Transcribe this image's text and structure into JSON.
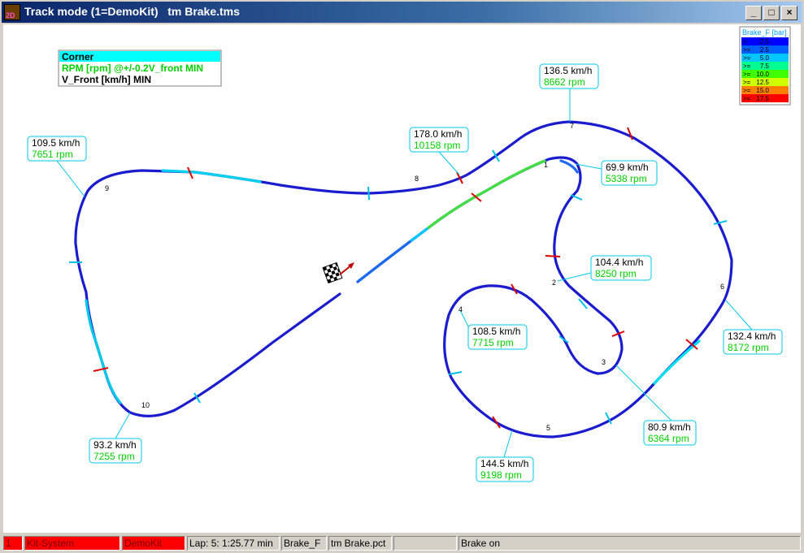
{
  "window": {
    "title": "Track mode (1=DemoKit)   tm Brake.tms",
    "app_icon_label": "2D",
    "minimize_glyph": "_",
    "maximize_glyph": "□",
    "close_glyph": "×"
  },
  "legend_box": {
    "title": "Corner",
    "line1": "RPM [rpm] @+/-0.2V_front MIN",
    "line2": "V_Front [km/h] MIN"
  },
  "color_scale": {
    "title": "Brake_F [bar]",
    "rows": [
      {
        "op": "<",
        "value": "2.5",
        "color": "#0000ff"
      },
      {
        "op": ">=",
        "value": "2.5",
        "color": "#0060ff"
      },
      {
        "op": ">=",
        "value": "5.0",
        "color": "#00c8ff"
      },
      {
        "op": ">=",
        "value": "7.5",
        "color": "#00ff90"
      },
      {
        "op": ">=",
        "value": "10.0",
        "color": "#40ff00"
      },
      {
        "op": ">=",
        "value": "12.5",
        "color": "#d0ff00"
      },
      {
        "op": ">=",
        "value": "15.0",
        "color": "#ff8000"
      },
      {
        "op": ">=",
        "value": "17.5",
        "color": "#ff0000"
      }
    ]
  },
  "corners": [
    {
      "num": "1",
      "speed": "69.9 km/h",
      "rpm": "5338 rpm"
    },
    {
      "num": "2",
      "speed": "104.4 km/h",
      "rpm": "8250 rpm"
    },
    {
      "num": "3",
      "speed": "80.9 km/h",
      "rpm": "6364 rpm"
    },
    {
      "num": "4",
      "speed": "108.5 km/h",
      "rpm": "7715 rpm"
    },
    {
      "num": "5",
      "speed": "144.5 km/h",
      "rpm": "9198 rpm"
    },
    {
      "num": "6",
      "speed": "132.4 km/h",
      "rpm": "8172 rpm"
    },
    {
      "num": "7",
      "speed": "136.5 km/h",
      "rpm": "8662 rpm"
    },
    {
      "num": "8",
      "speed": "178.0 km/h",
      "rpm": "10158 rpm"
    },
    {
      "num": "9",
      "speed": "109.5 km/h",
      "rpm": "7651 rpm"
    },
    {
      "num": "10",
      "speed": "93.2 km/h",
      "rpm": "7255 rpm"
    }
  ],
  "status": {
    "s1": "1",
    "s2": "Kit-System",
    "s3": "DemoKit",
    "s4": "Lap: 5: 1:25.77 min",
    "s5": "Brake_F",
    "s6": "tm Brake.pct",
    "s7": "",
    "s8": "Brake on"
  },
  "colors": {
    "track": "#1c1ccf",
    "cyan": "#00e0f0",
    "green": "#3be03b",
    "marker_red": "#e00000",
    "label_green": "#00d000"
  }
}
